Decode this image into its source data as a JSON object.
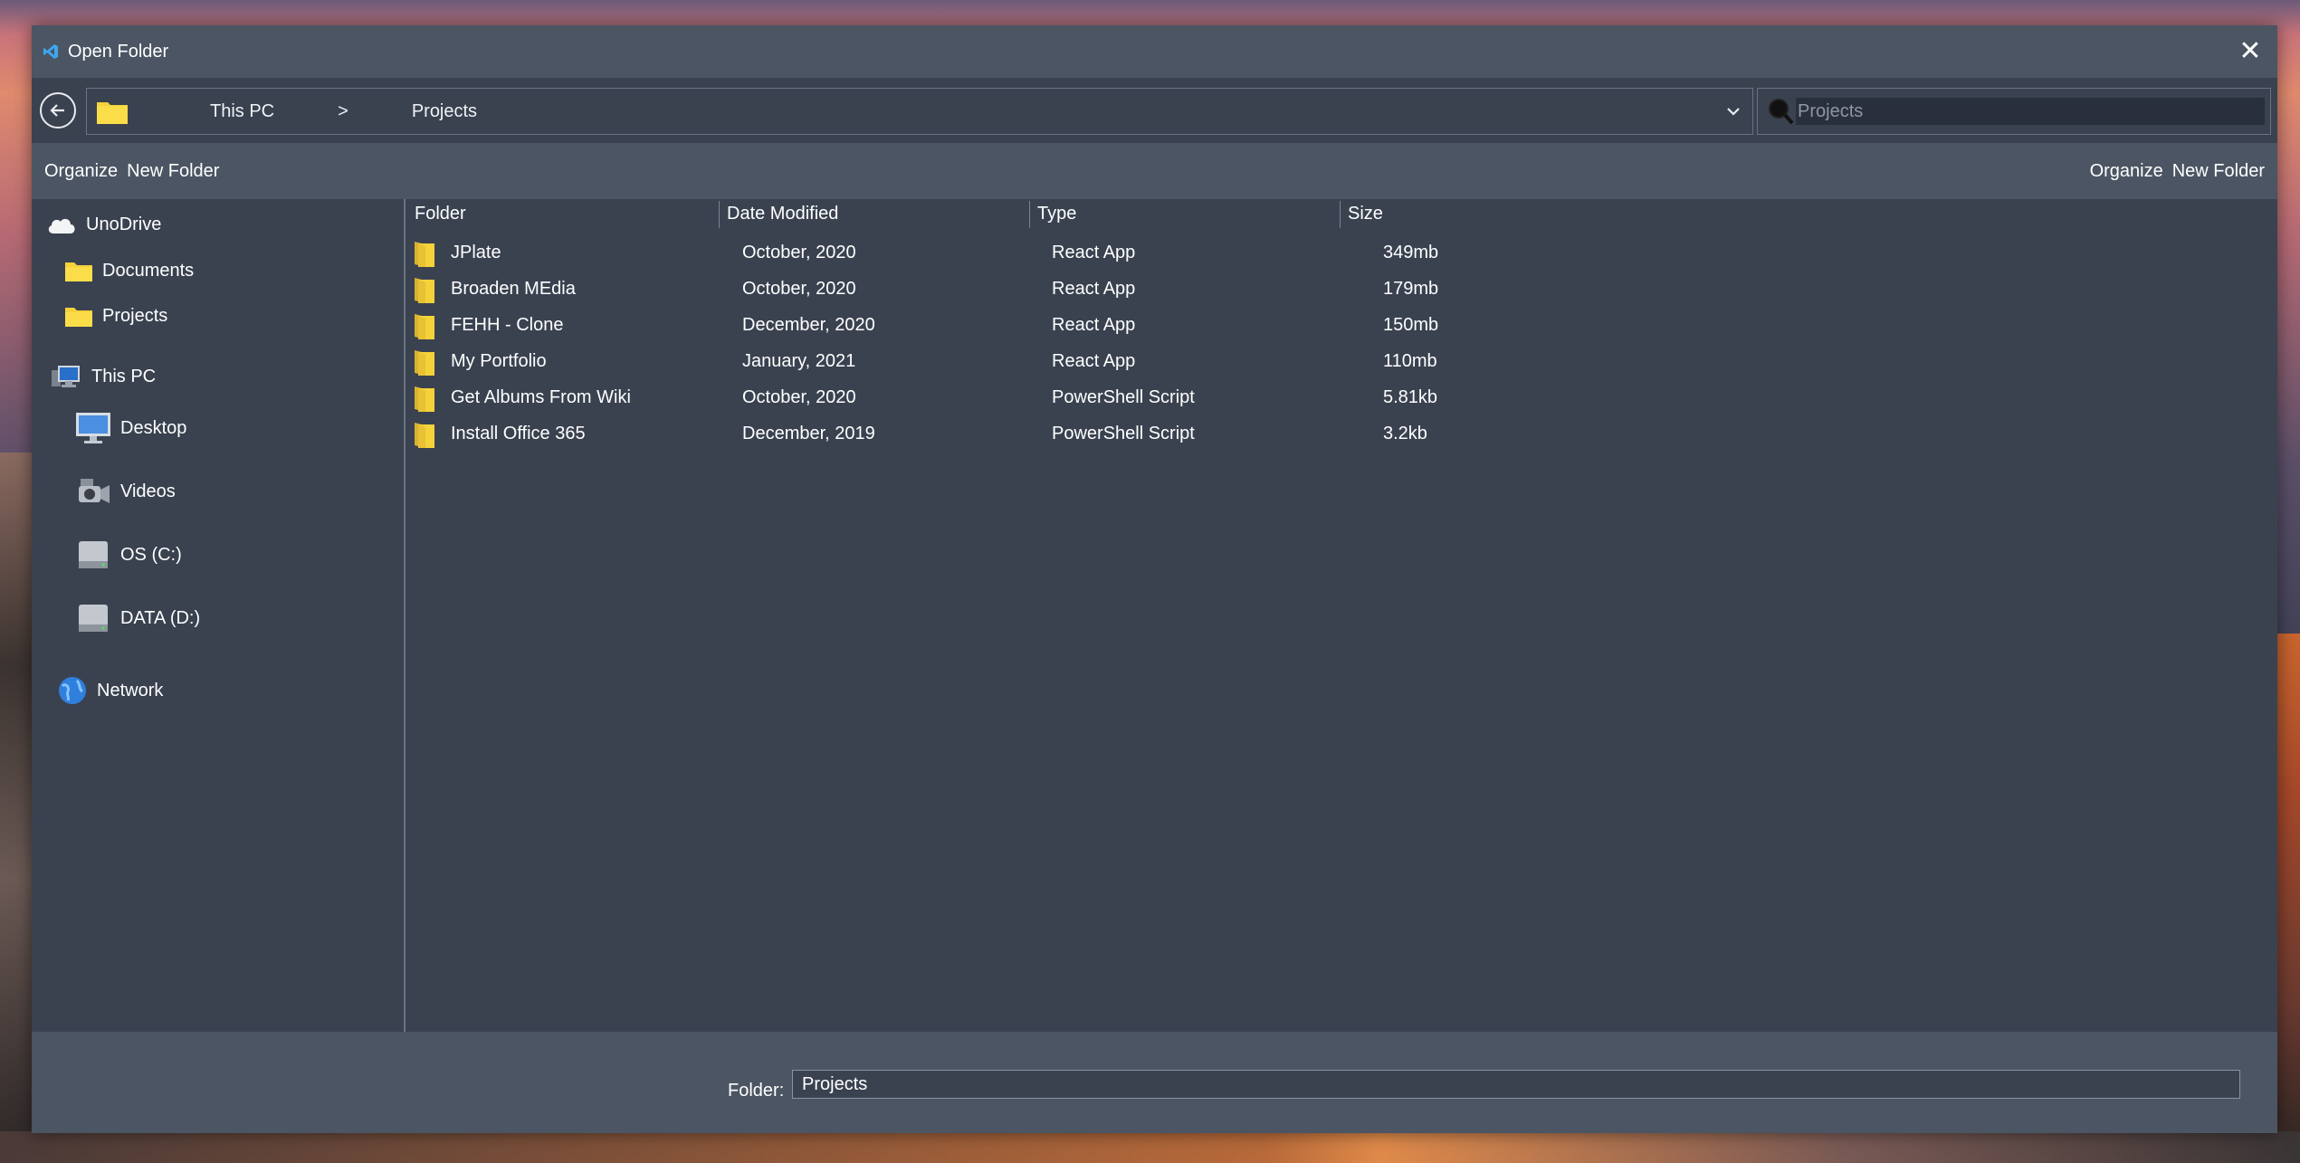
{
  "window": {
    "title": "Open Folder"
  },
  "address": {
    "crumbs": [
      "This PC",
      ">",
      "Projects"
    ],
    "search_placeholder": "Projects"
  },
  "toolbar": {
    "left": {
      "organize": "Organize",
      "new_folder": "New Folder"
    },
    "right": {
      "organize": "Organize",
      "new_folder": "New Folder"
    }
  },
  "sidebar": {
    "items": [
      {
        "label": "UnoDrive",
        "icon": "cloud-icon"
      },
      {
        "label": "Documents",
        "icon": "folder-icon"
      },
      {
        "label": "Projects",
        "icon": "folder-icon"
      },
      {
        "label": "This PC",
        "icon": "computer-icon"
      },
      {
        "label": "Desktop",
        "icon": "monitor-icon"
      },
      {
        "label": "Videos",
        "icon": "camera-icon"
      },
      {
        "label": "OS (C:)",
        "icon": "drive-icon"
      },
      {
        "label": "DATA (D:)",
        "icon": "drive-icon"
      },
      {
        "label": "Network",
        "icon": "globe-icon"
      }
    ]
  },
  "table": {
    "columns": [
      "Folder",
      "Date Modified",
      "Type",
      "Size"
    ],
    "rows": [
      {
        "name": "JPlate",
        "date": "October, 2020",
        "type": "React App",
        "size": "349mb"
      },
      {
        "name": "Broaden MEdia",
        "date": "October, 2020",
        "type": "React App",
        "size": "179mb"
      },
      {
        "name": "FEHH - Clone",
        "date": "December, 2020",
        "type": "React App",
        "size": "150mb"
      },
      {
        "name": "My Portfolio",
        "date": "January, 2021",
        "type": "React App",
        "size": "110mb"
      },
      {
        "name": "Get Albums From Wiki",
        "date": "October, 2020",
        "type": "PowerShell Script",
        "size": "5.81kb"
      },
      {
        "name": "Install Office 365",
        "date": "December, 2019",
        "type": "PowerShell Script",
        "size": "3.2kb"
      }
    ]
  },
  "footer": {
    "folder_label": "Folder:",
    "folder_value": "Projects"
  },
  "colors": {
    "panel": "#3a4250",
    "bar": "#4b5563",
    "folder": "#f5d13a"
  }
}
